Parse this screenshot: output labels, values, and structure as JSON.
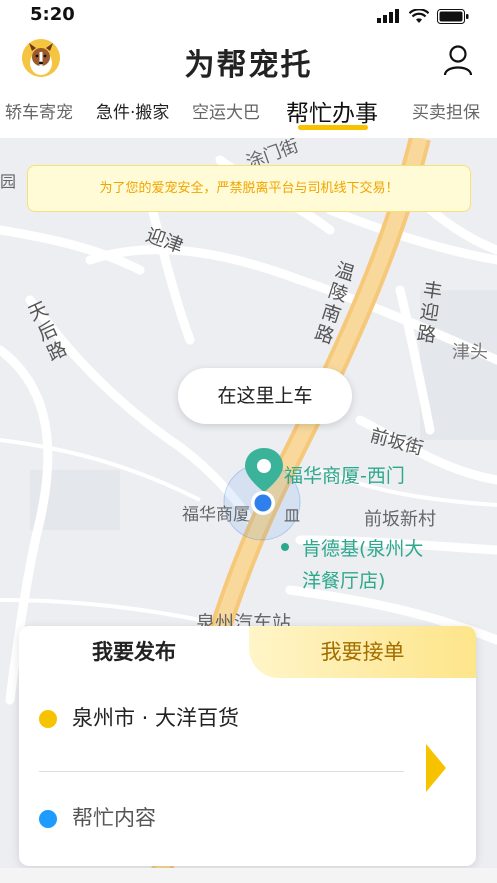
{
  "status_bar": {
    "time": "5:20"
  },
  "header": {
    "title": "为帮宠托"
  },
  "tabs": [
    {
      "label": "轿车寄宠"
    },
    {
      "label": "急件·搬家"
    },
    {
      "label": "空运大巴"
    },
    {
      "label": "帮忙办事"
    },
    {
      "label": "买卖担保"
    }
  ],
  "active_tab_index": 3,
  "notice": {
    "text": "为了您的爱宠安全，严禁脱离平台与司机线下交易！"
  },
  "map": {
    "pickup_bubble": "在这里上车",
    "labels": {
      "road_1": "迎津",
      "road_2": "天后路",
      "road_3": "温陵南路",
      "road_4": "丰迎路",
      "road_5": "津头",
      "road_6": "前坂街",
      "area_1": "前坂新村",
      "poi_1": "福华商厦-西门",
      "poi_2": "福华商厦",
      "poi_2b": "皿",
      "poi_3_line1": "肯德基(泉州大",
      "poi_3_line2": "洋餐厅店)",
      "station": "泉州汽车站",
      "partial_top": "涂门街",
      "partial_left": "园"
    },
    "colors": {
      "road_major": "#f6c87a",
      "road_minor": "#ffffff",
      "marker": "#3bb39a",
      "location": "#2f80ed"
    }
  },
  "panel": {
    "tab_post": "我要发布",
    "tab_accept": "我要接单",
    "location": "泉州市 · 大洋百货",
    "content_placeholder": "帮忙内容",
    "colors": {
      "dot_location": "#f7c300",
      "dot_content": "#1e9bff",
      "arrow": "#f7c300"
    }
  }
}
